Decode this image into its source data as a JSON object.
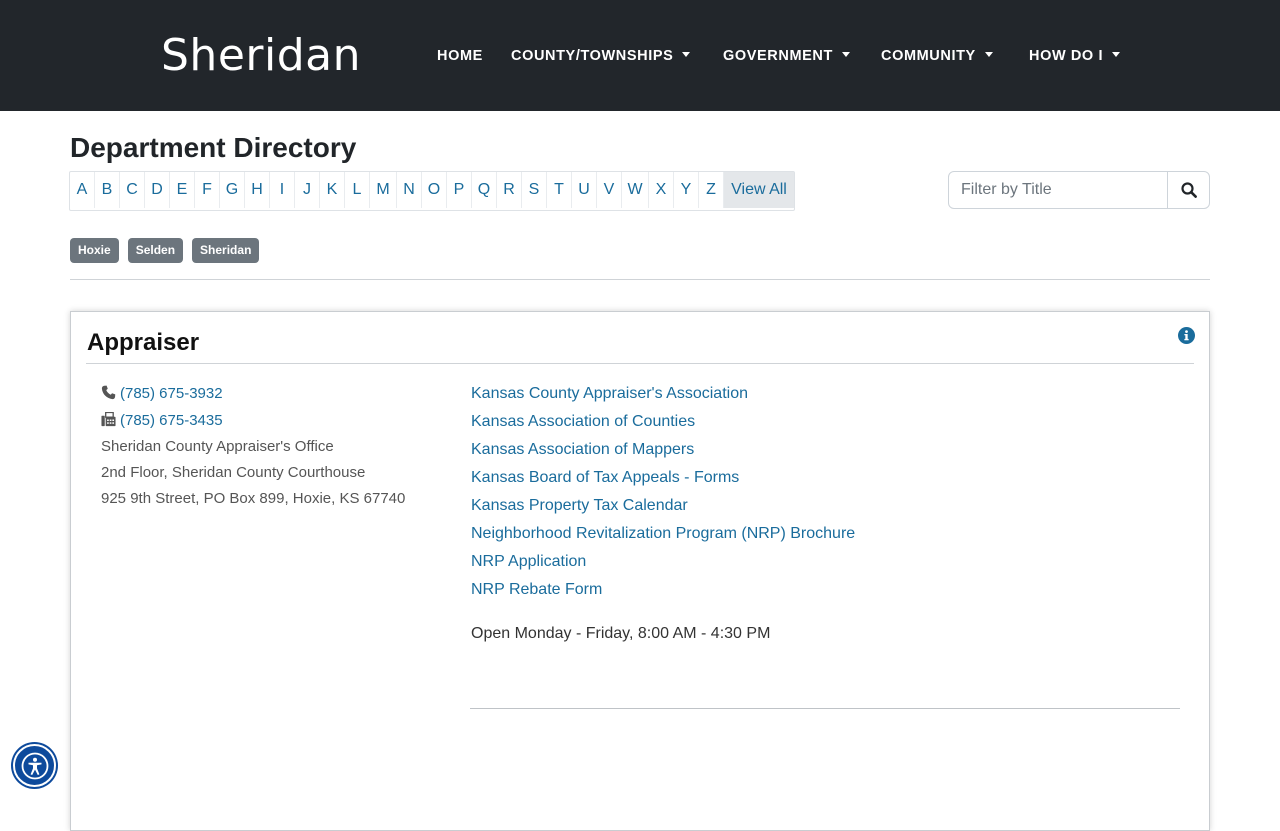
{
  "header": {
    "brand": "Sheridan",
    "nav": [
      {
        "label": "HOME",
        "dropdown": false
      },
      {
        "label": "COUNTY/TOWNSHIPS",
        "dropdown": true
      },
      {
        "label": "GOVERNMENT",
        "dropdown": true
      },
      {
        "label": "COMMUNITY",
        "dropdown": true
      },
      {
        "label": "HOW DO I",
        "dropdown": true
      }
    ]
  },
  "page": {
    "title": "Department Directory"
  },
  "alphabet": [
    "A",
    "B",
    "C",
    "D",
    "E",
    "F",
    "G",
    "H",
    "I",
    "J",
    "K",
    "L",
    "M",
    "N",
    "O",
    "P",
    "Q",
    "R",
    "S",
    "T",
    "U",
    "V",
    "W",
    "X",
    "Y",
    "Z",
    "View All"
  ],
  "alphabet_active": "View All",
  "filter": {
    "placeholder": "Filter by Title",
    "button_icon": "search-icon"
  },
  "tags": [
    "Hoxie",
    "Selden",
    "Sheridan"
  ],
  "department": {
    "name": "Appraiser",
    "phone": "(785) 675-3932",
    "fax": "(785) 675-3435",
    "address_lines": [
      "Sheridan County Appraiser's Office",
      "2nd Floor, Sheridan County Courthouse",
      "925 9th Street, PO Box 899, Hoxie, KS 67740"
    ],
    "links": [
      "Kansas County Appraiser's Association",
      "Kansas Association of Counties",
      "Kansas Association of Mappers",
      "Kansas Board of Tax Appeals - Forms",
      "Kansas Property Tax Calendar",
      "Neighborhood Revitalization Program (NRP) Brochure",
      "NRP Application",
      "NRP Rebate Form"
    ],
    "hours": "Open Monday - Friday, 8:00 AM - 4:30 PM"
  },
  "colors": {
    "header_bg": "#22262b",
    "link": "#1a6c9c",
    "tag_bg": "#6c757d",
    "accessibility_button": "#0d4a9c"
  }
}
